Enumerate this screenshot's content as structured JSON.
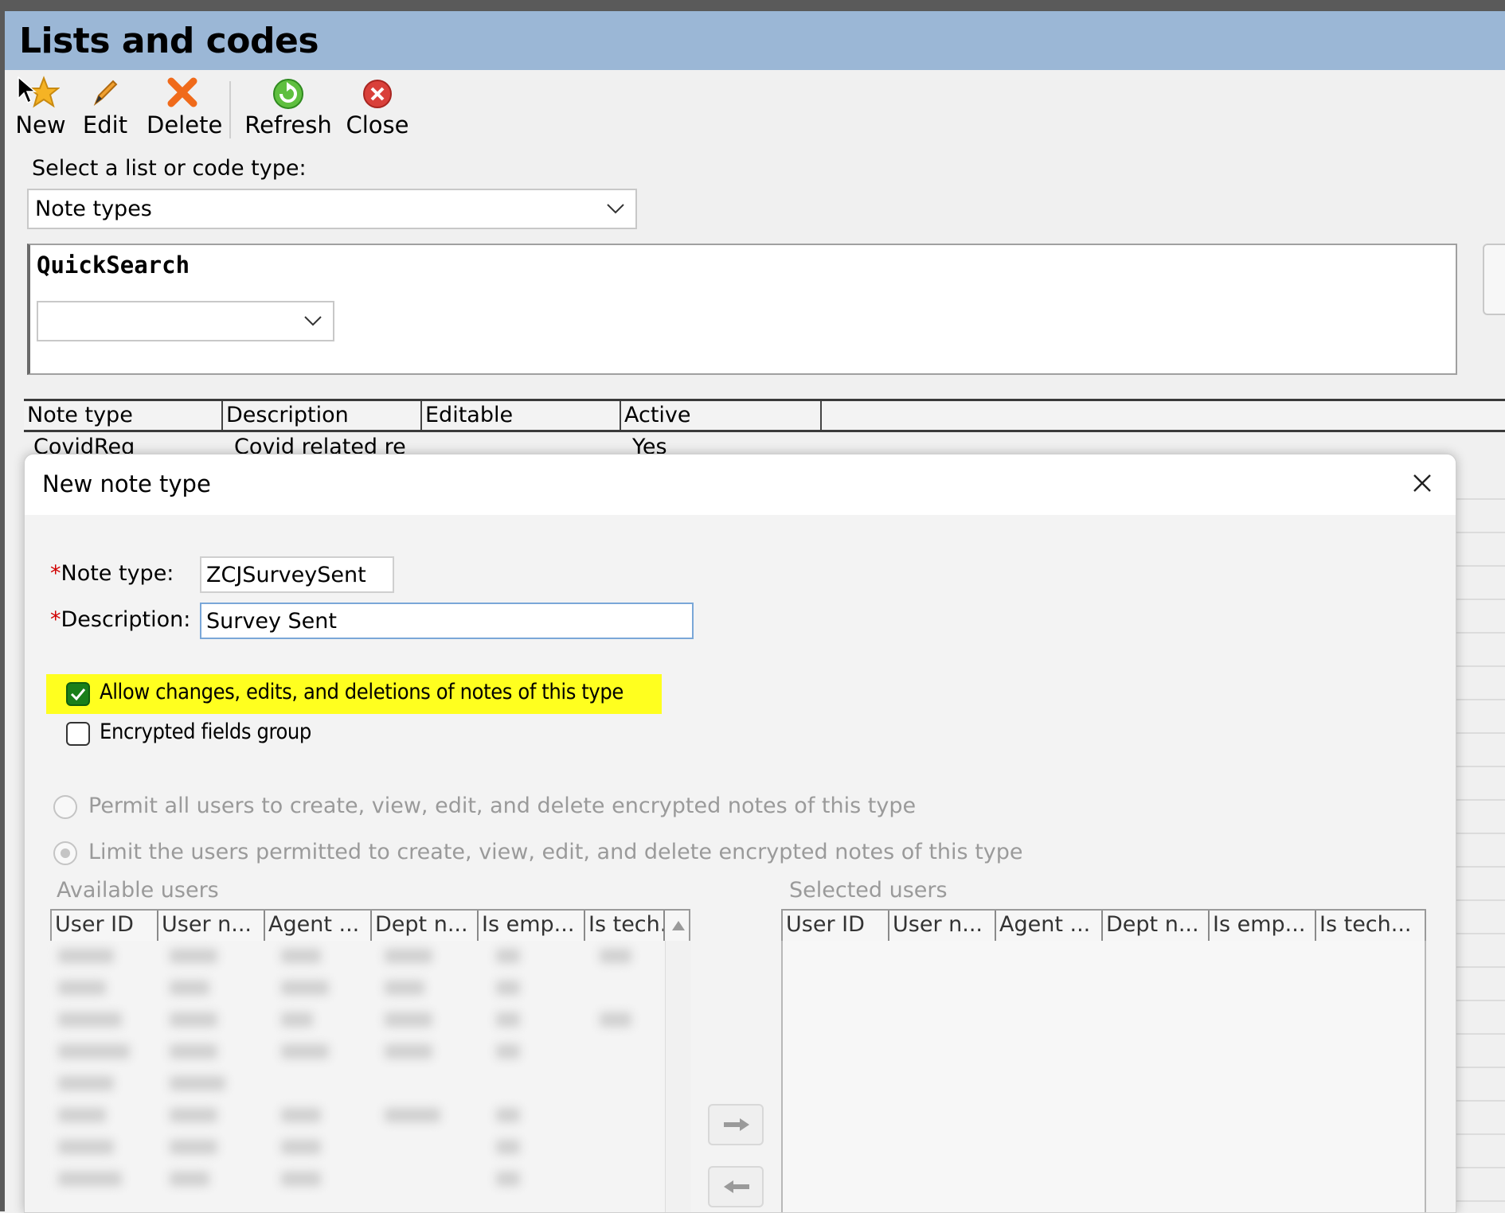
{
  "window": {
    "title": "Lists and codes"
  },
  "toolbar": {
    "new_label": "New",
    "edit_label": "Edit",
    "delete_label": "Delete",
    "refresh_label": "Refresh",
    "close_label": "Close"
  },
  "list_select": {
    "label": "Select a list or code type:",
    "value": "Note types"
  },
  "quicksearch": {
    "title": "QuickSearch",
    "value": ""
  },
  "grid": {
    "columns": [
      "Note type",
      "Description",
      "Editable",
      "Active"
    ],
    "rows": [
      {
        "note_type": "CovidReq",
        "description": "Covid related re",
        "editable": "",
        "active": "Yes"
      }
    ]
  },
  "dialog": {
    "title": "New note type",
    "note_type_label": "Note type:",
    "note_type_value": "ZCJSurveySent",
    "description_label": "Description:",
    "description_value": "Survey Sent",
    "required_marker": "*",
    "allow_changes_label": "Allow changes, edits, and deletions of notes of this type",
    "allow_changes_checked": true,
    "encrypted_label": "Encrypted fields group",
    "encrypted_checked": false,
    "permit_all_label": "Permit all users to create, view, edit, and delete encrypted notes of this type",
    "limit_users_label": "Limit the users permitted to create, view, edit, and delete encrypted notes of this type",
    "available_users_label": "Available users",
    "selected_users_label": "Selected users",
    "user_columns": [
      "User ID",
      "User n...",
      "Agent ...",
      "Dept n...",
      "Is emp...",
      "Is tech..."
    ],
    "available_last_col": "Is tech."
  },
  "colors": {
    "titlebar": "#9bb7d6",
    "highlight": "#ffff1f",
    "checkbox_on": "#1a7f1a",
    "required": "#d00000"
  }
}
